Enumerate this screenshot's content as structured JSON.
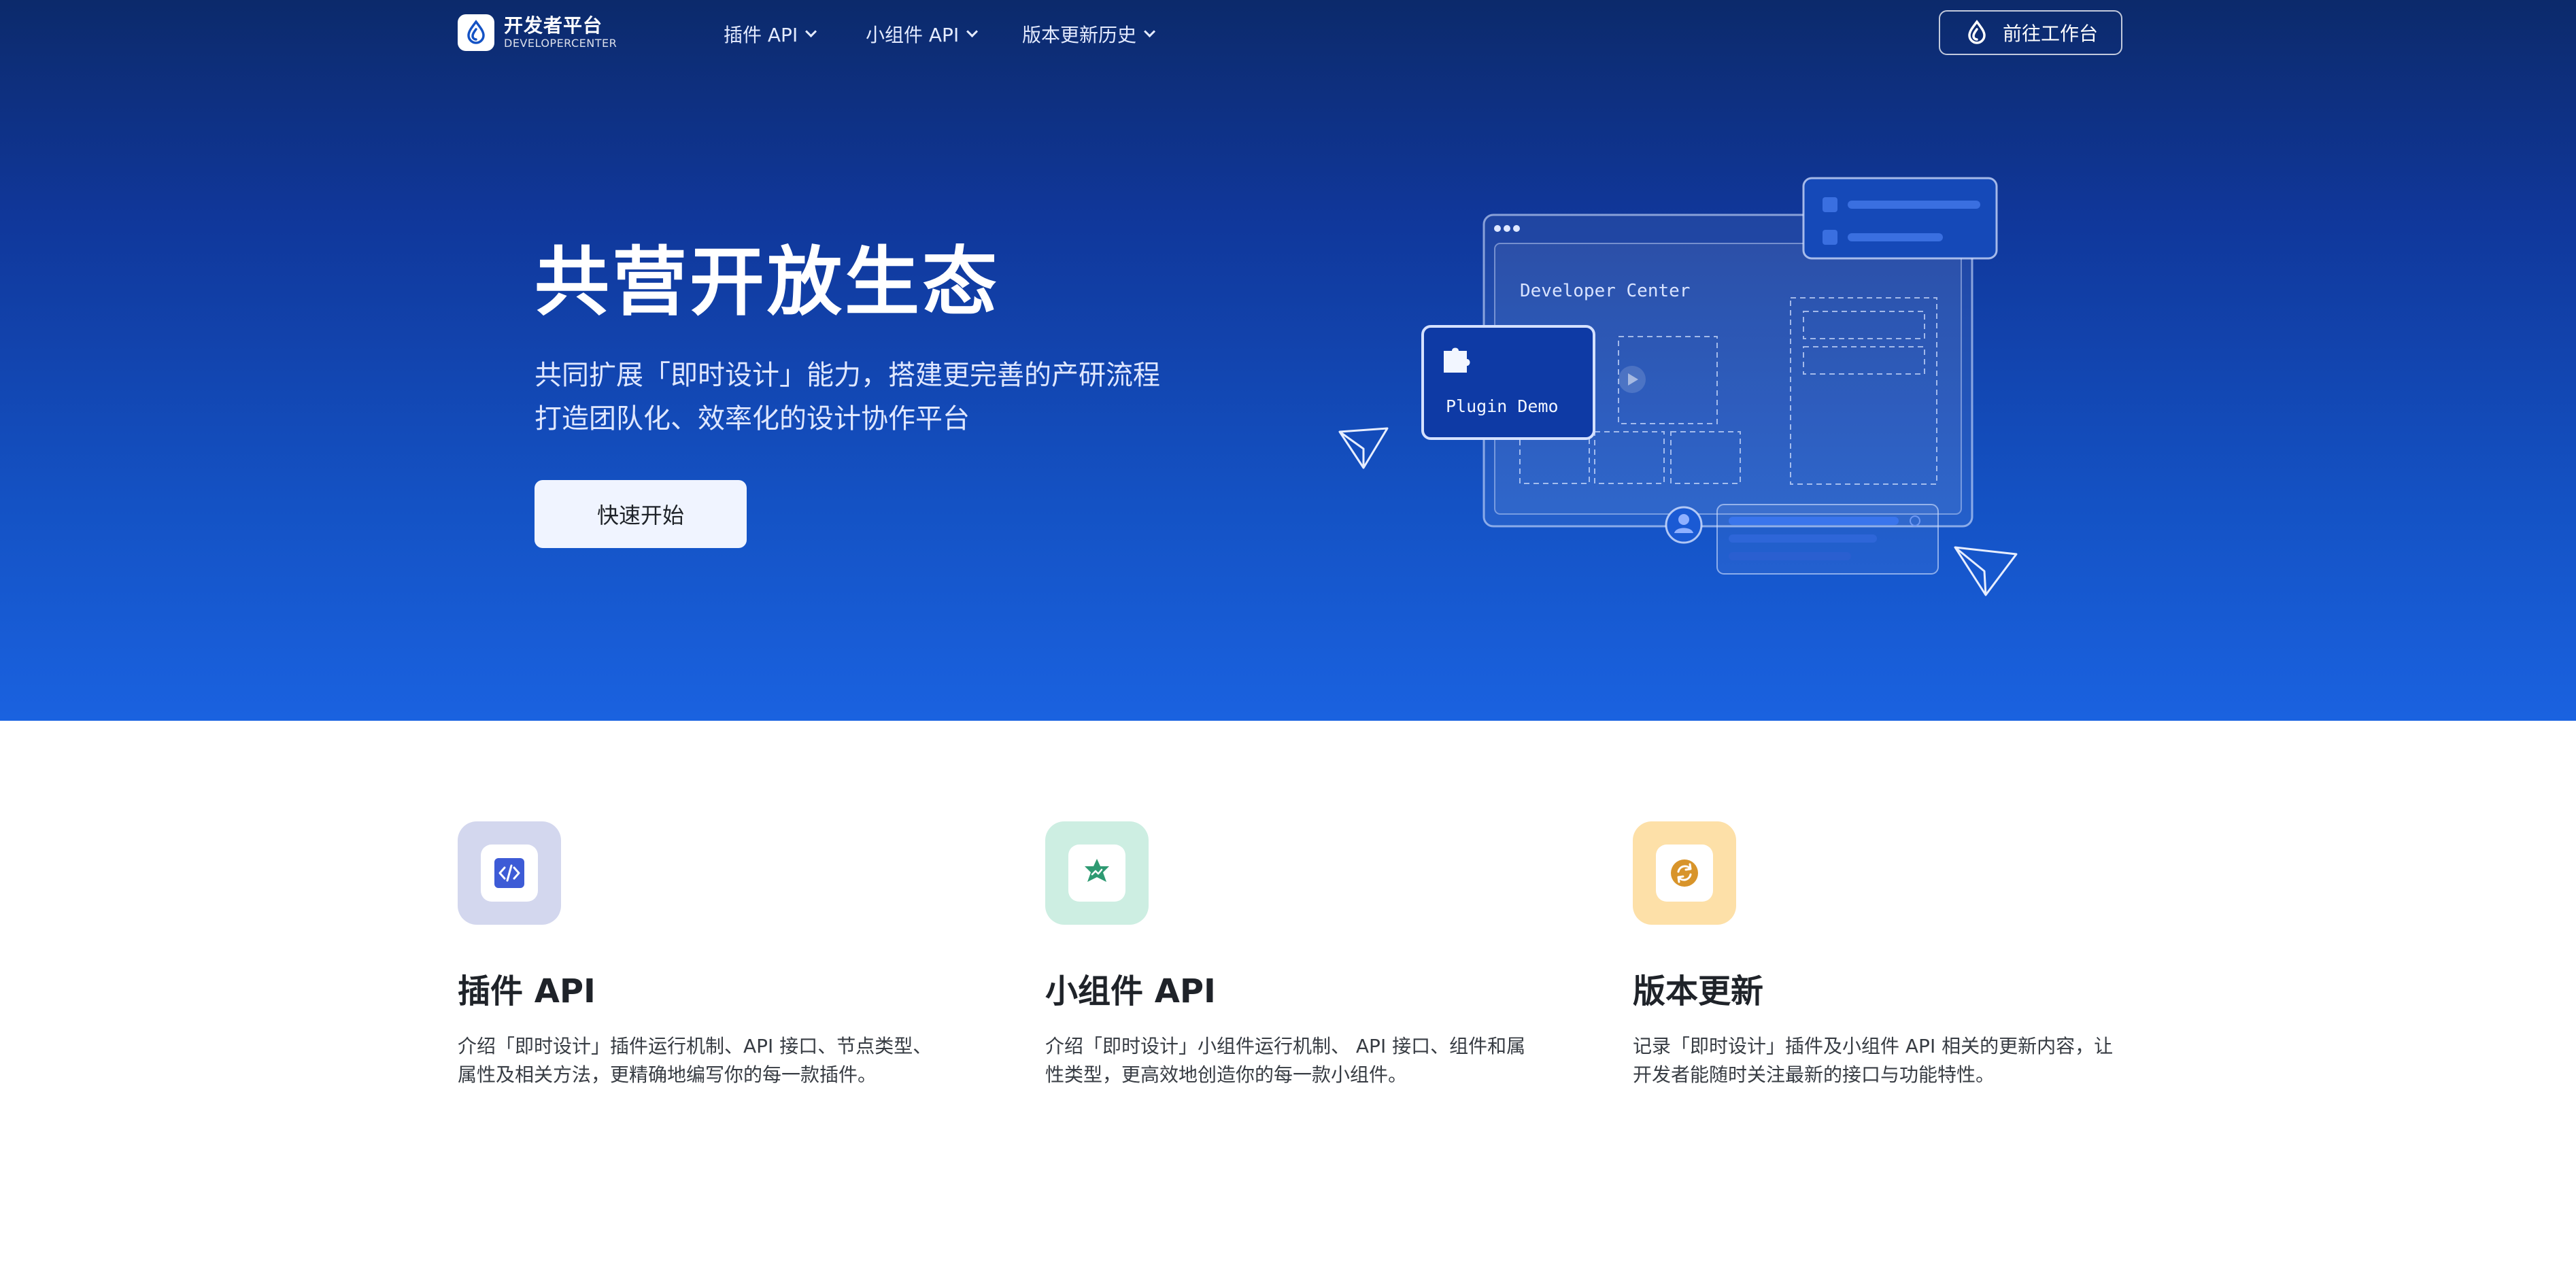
{
  "brand": {
    "title": "开发者平台",
    "subtitle": "DEVELOPERCENTER",
    "logo_icon": "droplet-logo-icon"
  },
  "nav": {
    "items": [
      {
        "label": "插件 API"
      },
      {
        "label": "小组件 API"
      },
      {
        "label": "版本更新历史"
      }
    ],
    "workspace_button": "前往工作台"
  },
  "hero": {
    "title": "共营开放生态",
    "subtitle_line1": "共同扩展「即时设计」能力，搭建更完善的产研流程",
    "subtitle_line2": "打造团队化、效率化的设计协作平台",
    "cta_label": "快速开始",
    "illustration": {
      "window_title": "Developer Center",
      "plugin_card_label": "Plugin Demo"
    }
  },
  "features": [
    {
      "title": "插件 API",
      "description": "介绍「即时设计」插件运行机制、API 接口、节点类型、属性及相关方法，更精确地编写你的每一款插件。",
      "icon": "code-icon",
      "tile_color": "#d3d7ee",
      "accent": "#3d5bd6"
    },
    {
      "title": "小组件 API",
      "description": "介绍「即时设计」小组件运行机制、 API 接口、组件和属性类型，更高效地创造你的每一款小组件。",
      "icon": "star-badge-icon",
      "tile_color": "#cdeee2",
      "accent": "#2e9a72"
    },
    {
      "title": "版本更新",
      "description": "记录「即时设计」插件及小组件 API 相关的更新内容，让开发者能随时关注最新的接口与功能特性。",
      "icon": "refresh-icon",
      "tile_color": "#fde0a8",
      "accent": "#d8942a"
    }
  ],
  "colors": {
    "hero_top": "#0c2a6b",
    "hero_bottom": "#1a62e0",
    "cta_bg": "#f0f4ff"
  }
}
